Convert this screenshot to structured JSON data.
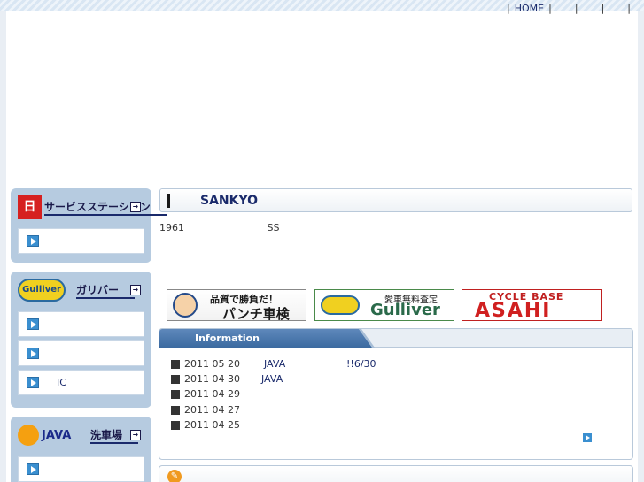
{
  "topnav": {
    "items": [
      "HOME",
      "",
      "",
      ""
    ]
  },
  "sidebar": {
    "boxes": [
      {
        "title": "サービスステーション",
        "logo": "日",
        "items": [
          ""
        ]
      },
      {
        "title": "ガリバー",
        "logo": "Gulliver",
        "items": [
          "",
          "",
          "IC"
        ]
      },
      {
        "title": "洗車場",
        "logo": "JAVA",
        "items": [
          ""
        ]
      }
    ]
  },
  "main": {
    "title": "SANKYO",
    "intro": [
      "1961",
      "SS"
    ]
  },
  "banners": [
    {
      "line1": "品質で勝負だ！",
      "line2": "パンチ車検"
    },
    {
      "line1": "愛車無料査定",
      "line2": "Gulliver"
    },
    {
      "line1": "CYCLE BASE",
      "line2": "ASAHI"
    }
  ],
  "info": {
    "heading": "Information",
    "rows": [
      {
        "date": "2011 05 20",
        "title": "JAVA",
        "extra": "!!6/30"
      },
      {
        "date": "2011 04 30",
        "title": "JAVA",
        "extra": ""
      },
      {
        "date": "2011 04 29",
        "title": "",
        "extra": ""
      },
      {
        "date": "2011 04 27",
        "title": "",
        "extra": ""
      },
      {
        "date": "2011 04 25",
        "title": "",
        "extra": ""
      }
    ]
  },
  "colors": {
    "accent": "#3b6aa0",
    "sidebar_bg": "#b6cbe0",
    "link": "#1a2a6b"
  }
}
